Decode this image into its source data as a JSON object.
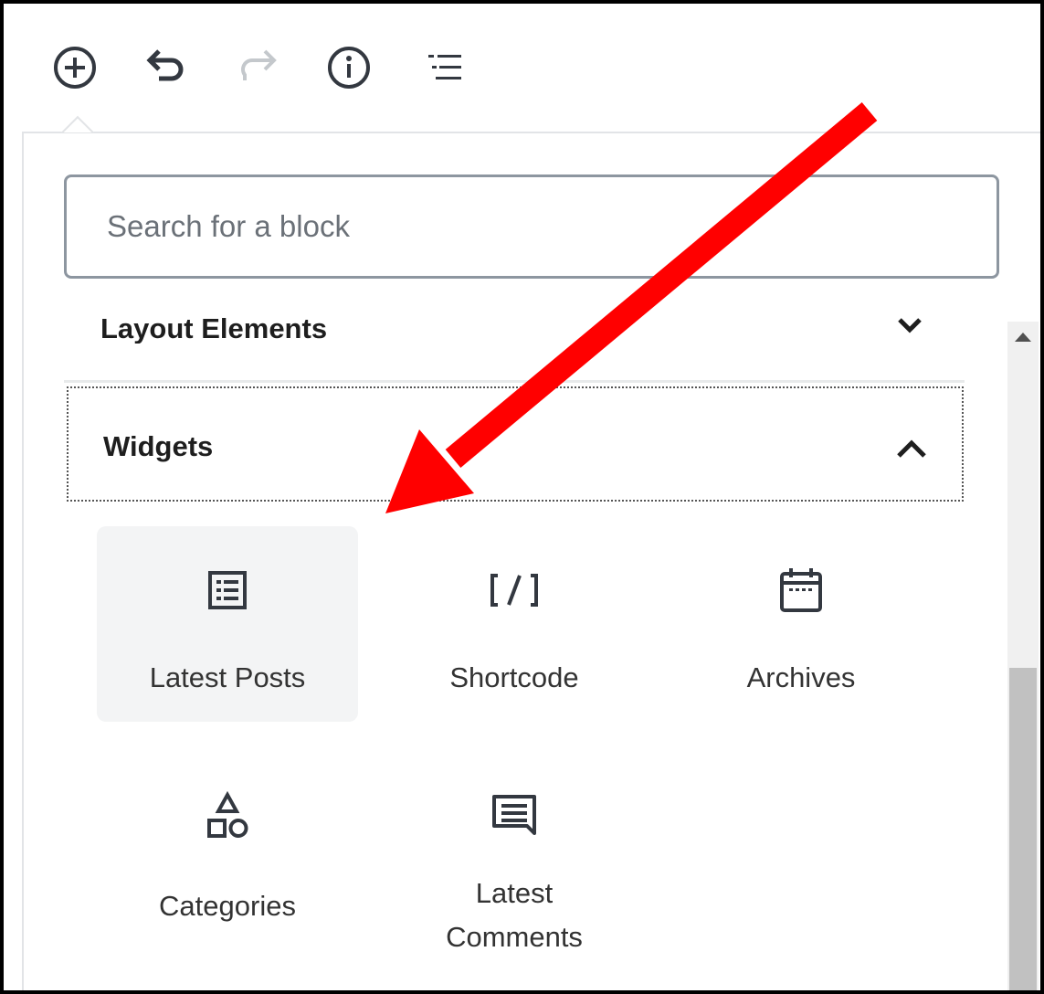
{
  "toolbar": {
    "buttons": [
      {
        "name": "add-block",
        "icon": "plus-circle-icon"
      },
      {
        "name": "undo",
        "icon": "undo-icon"
      },
      {
        "name": "redo",
        "icon": "redo-icon",
        "disabled": true
      },
      {
        "name": "info",
        "icon": "info-icon"
      },
      {
        "name": "block-navigation",
        "icon": "list-icon"
      }
    ]
  },
  "inserter": {
    "search": {
      "placeholder": "Search for a block",
      "value": ""
    },
    "panels": [
      {
        "title": "Layout Elements",
        "expanded": false
      },
      {
        "title": "Widgets",
        "expanded": true
      }
    ],
    "widgets": [
      {
        "label": "Latest Posts",
        "icon": "list-view-icon",
        "active": true
      },
      {
        "label": "Shortcode",
        "icon": "shortcode-icon",
        "active": false
      },
      {
        "label": "Archives",
        "icon": "calendar-icon",
        "active": false
      },
      {
        "label": "Categories",
        "icon": "categories-icon",
        "active": false
      },
      {
        "label": "Latest Comments",
        "icon": "comment-icon",
        "active": false
      }
    ]
  },
  "colors": {
    "annotation_arrow": "#ff0000",
    "icon": "#333840",
    "icon_disabled": "#c4c8cc",
    "active_tile_bg": "#f3f4f5"
  }
}
